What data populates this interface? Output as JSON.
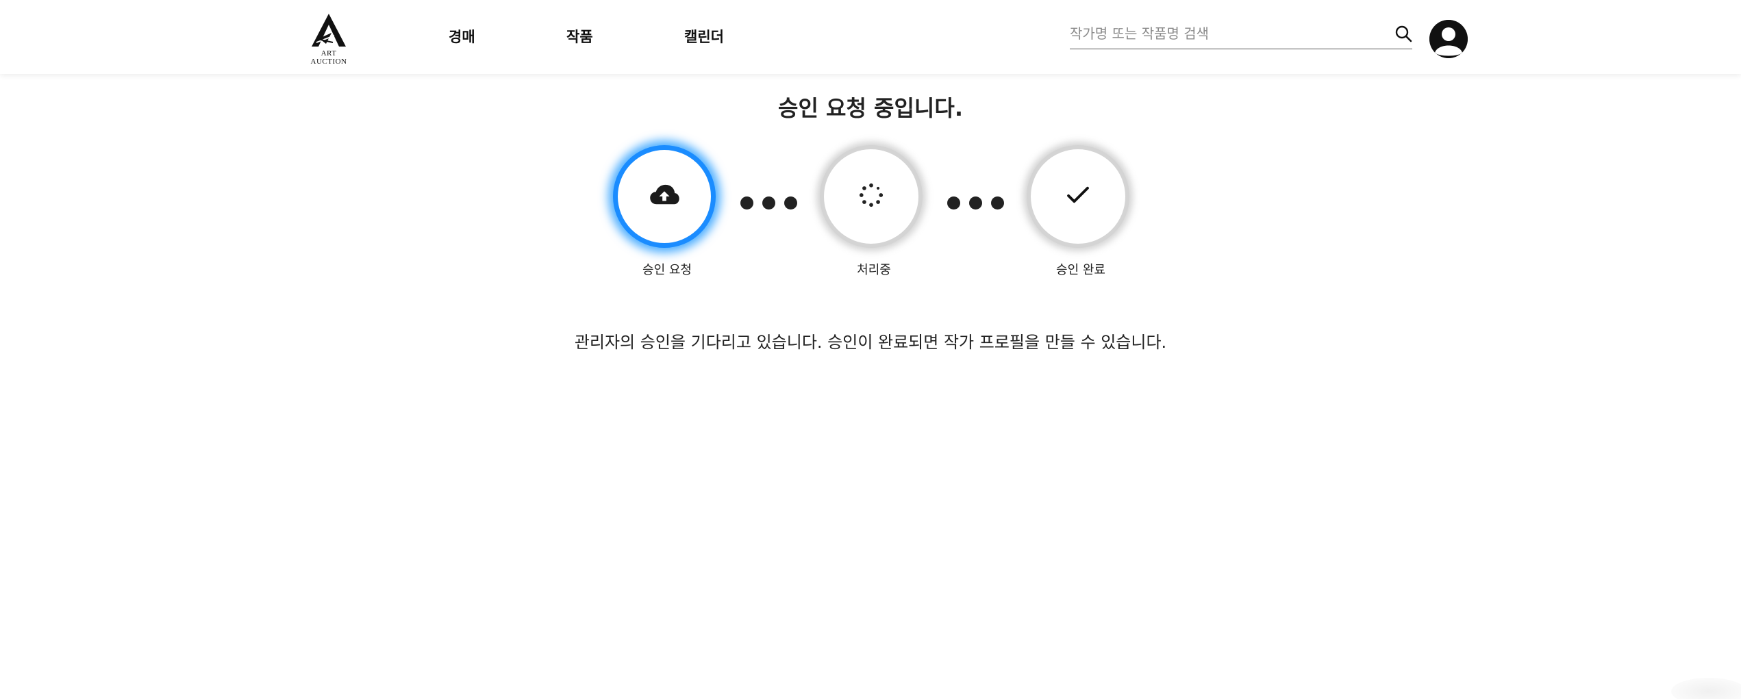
{
  "header": {
    "logo_text": "ART AUCTION",
    "nav": {
      "auction": "경매",
      "works": "작품",
      "calendar": "캘린더"
    },
    "search": {
      "placeholder": "작가명 또는 작품명 검색",
      "value": "",
      "icon": "search-icon"
    },
    "profile_icon": "user-avatar-icon"
  },
  "main": {
    "title": "승인 요청 중입니다.",
    "steps": [
      {
        "label": "승인 요청",
        "icon": "cloud-upload-icon",
        "state": "active"
      },
      {
        "label": "처리중",
        "icon": "spinner-icon",
        "state": "inactive"
      },
      {
        "label": "승인 완료",
        "icon": "check-icon",
        "state": "inactive"
      }
    ],
    "message": "관리자의 승인을 기다리고 있습니다. 승인이 완료되면 작가 프로필을 만들 수 있습니다."
  },
  "colors": {
    "accent": "#1a8cff",
    "inactive_ring": "#d4d4d4",
    "text": "#222222"
  }
}
